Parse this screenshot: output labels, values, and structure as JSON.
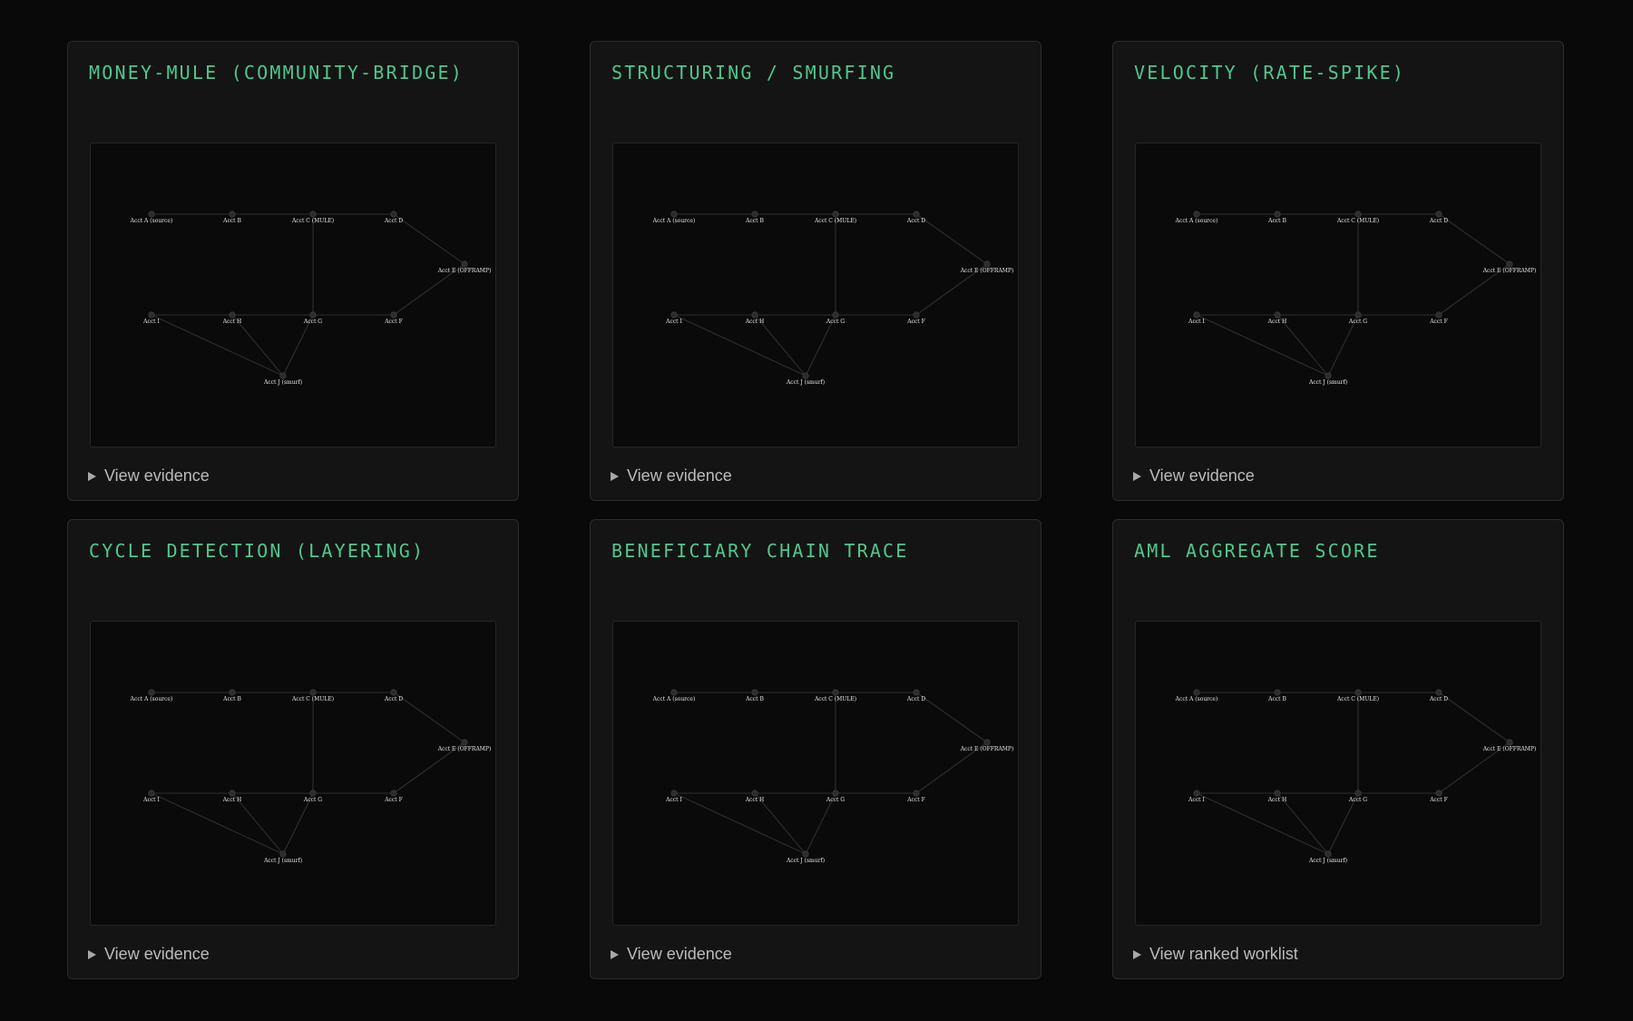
{
  "cards": [
    {
      "title": "MONEY-MULE (COMMUNITY-BRIDGE)",
      "toggle_label": "View evidence"
    },
    {
      "title": "STRUCTURING / SMURFING",
      "toggle_label": "View evidence"
    },
    {
      "title": "VELOCITY (RATE-SPIKE)",
      "toggle_label": "View evidence"
    },
    {
      "title": "CYCLE DETECTION (LAYERING)",
      "toggle_label": "View evidence"
    },
    {
      "title": "BENEFICIARY CHAIN TRACE",
      "toggle_label": "View evidence"
    },
    {
      "title": "AML AGGREGATE SCORE",
      "toggle_label": "View ranked worklist"
    }
  ],
  "graph": {
    "nodes": [
      {
        "id": "A",
        "label": "Acct A (source)"
      },
      {
        "id": "B",
        "label": "Acct B"
      },
      {
        "id": "C",
        "label": "Acct C (MULE)"
      },
      {
        "id": "D",
        "label": "Acct D"
      },
      {
        "id": "E",
        "label": "Acct E (OFFRAMP)"
      },
      {
        "id": "F",
        "label": "Acct F"
      },
      {
        "id": "G",
        "label": "Acct G"
      },
      {
        "id": "H",
        "label": "Acct H"
      },
      {
        "id": "I",
        "label": "Acct I"
      },
      {
        "id": "J",
        "label": "Acct J (smurf)"
      }
    ],
    "edges": [
      [
        "A",
        "B"
      ],
      [
        "B",
        "C"
      ],
      [
        "C",
        "D"
      ],
      [
        "D",
        "E"
      ],
      [
        "E",
        "F"
      ],
      [
        "F",
        "G"
      ],
      [
        "G",
        "H"
      ],
      [
        "H",
        "I"
      ],
      [
        "C",
        "G"
      ],
      [
        "I",
        "J"
      ],
      [
        "H",
        "J"
      ],
      [
        "G",
        "J"
      ]
    ]
  },
  "colors": {
    "accent": "#4fc88e",
    "card_bg": "#141414",
    "page_bg": "#090909"
  }
}
